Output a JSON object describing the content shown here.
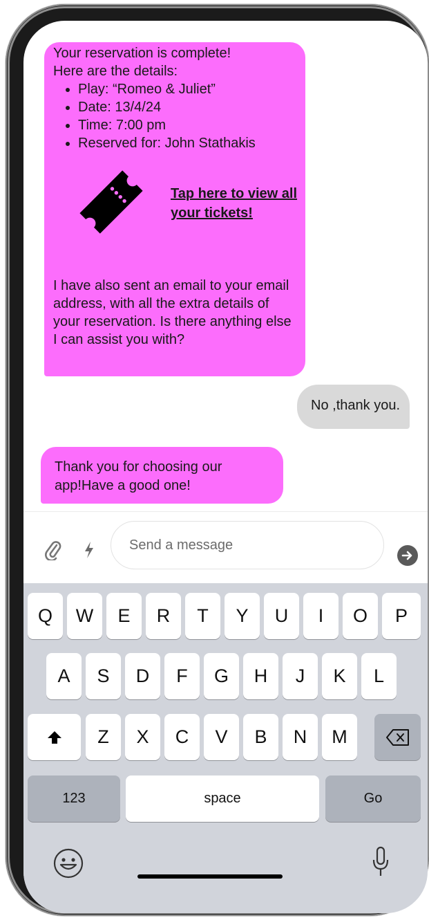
{
  "chat": {
    "bot_message_1": {
      "intro_line1": "Your reservation is complete!",
      "intro_line2": "Here are the details:",
      "details": [
        "Play: “Romeo & Juliet”",
        "Date: 13/4/24",
        "Time: 7:00 pm",
        "Reserved for: John Stathakis"
      ],
      "ticket_link": "Tap here to view all your tickets!",
      "ticket_icon": "ticket-icon",
      "followup": "I have also sent an email to your email address, with all the extra details of your reservation. Is there anything else I can assist you with?"
    },
    "user_message_1": "No ,thank you.",
    "bot_message_2": "Thank you for choosing our app!Have a good one!"
  },
  "composer": {
    "placeholder": "Send a message",
    "attach_icon": "paperclip-icon",
    "quick_icon": "lightning-icon",
    "send_icon": "send-arrow-icon"
  },
  "keyboard": {
    "row1": [
      "Q",
      "W",
      "E",
      "R",
      "T",
      "Y",
      "U",
      "I",
      "O",
      "P"
    ],
    "row2": [
      "A",
      "S",
      "D",
      "F",
      "G",
      "H",
      "J",
      "K",
      "L"
    ],
    "row3": [
      "Z",
      "X",
      "C",
      "V",
      "B",
      "N",
      "M"
    ],
    "numbers_label": "123",
    "space_label": "space",
    "go_label": "Go",
    "shift_icon": "shift-icon",
    "backspace_icon": "backspace-icon",
    "emoji_icon": "emoji-icon",
    "mic_icon": "microphone-icon"
  },
  "colors": {
    "bot_bubble": "#fc6dfc",
    "user_bubble": "#d9d9d9",
    "keyboard_bg": "#d1d4db"
  }
}
